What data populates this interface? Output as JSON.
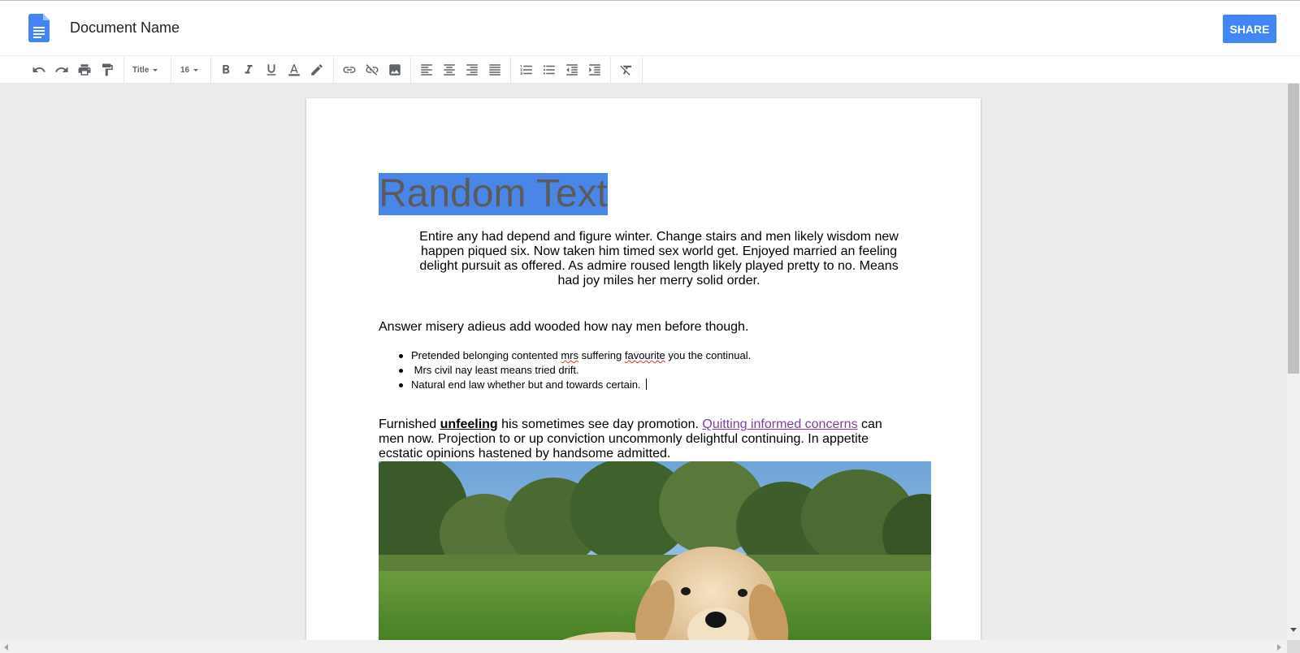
{
  "header": {
    "doc_name": "Document Name",
    "share_label": "SHARE",
    "icon": "google-docs-icon"
  },
  "toolbar": {
    "style_value": "Title",
    "size_value": "16",
    "icons": [
      "undo-icon",
      "redo-icon",
      "print-icon",
      "paint-format-icon",
      "bold-icon",
      "italic-icon",
      "underline-icon",
      "text-color-icon",
      "highlight-icon",
      "link-icon",
      "unlink-icon",
      "image-icon",
      "align-left-icon",
      "align-center-icon",
      "align-right-icon",
      "align-justify-icon",
      "numbered-list-icon",
      "bulleted-list-icon",
      "decrease-indent-icon",
      "increase-indent-icon",
      "clear-formatting-icon"
    ]
  },
  "document": {
    "title": "Random Text",
    "centered_paragraph": "Entire any had depend and figure winter. Change stairs and men likely wisdom new happen piqued six. Now taken him timed sex world get. Enjoyed married an feeling delight pursuit as offered. As admire roused length likely played pretty to no. Means had joy miles her merry solid order.",
    "answer_paragraph": "Answer misery adieus add wooded how nay men before though.",
    "bullets": [
      {
        "pre": "Pretended belonging contented ",
        "sp1": "mrs",
        "mid": " suffering ",
        "sp2": "favourite",
        "post": " you the continual."
      },
      {
        "text": " Mrs civil nay least means tried drift."
      },
      {
        "text": "Natural end law whether but and towards certain. "
      }
    ],
    "furnished": {
      "pre": "Furnished ",
      "bold": "unfeeling",
      "mid": " his sometimes see day promotion. ",
      "link": "Quitting informed concerns",
      "post": " can men now. Projection to or up conviction uncommonly delightful continuing. In appetite ecstatic opinions hastened by handsome admitted."
    }
  },
  "colors": {
    "share_button": "#4285f4",
    "title_selection": "#4a86e8",
    "link": "#7b3fa0"
  }
}
